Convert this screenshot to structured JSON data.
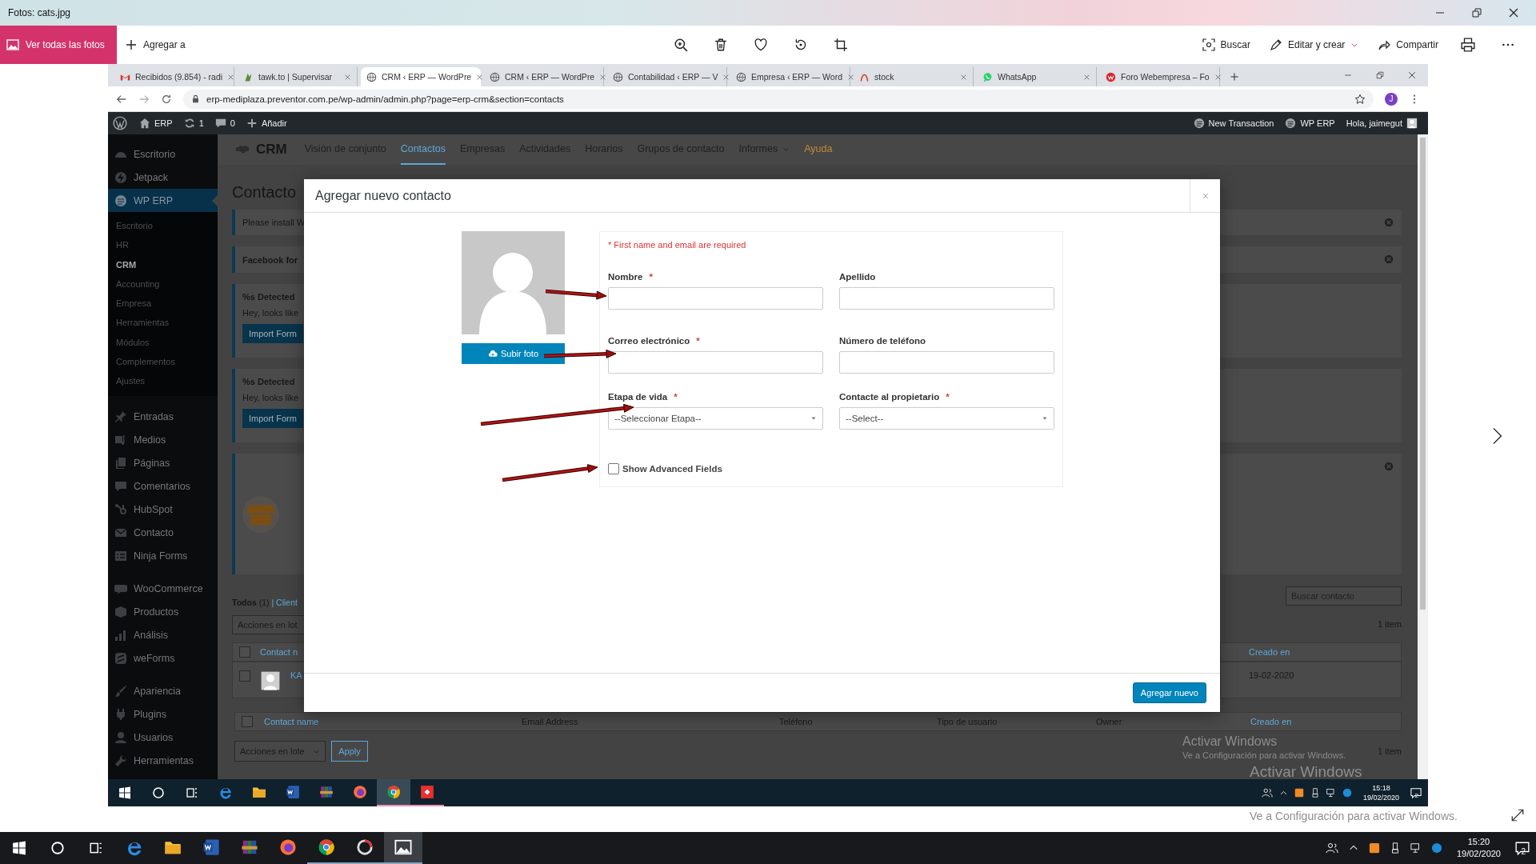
{
  "viewer": {
    "title": "Fotos: cats.jpg",
    "all_photos": "Ver todas las fotos",
    "add_to": "Agregar a",
    "search": "Buscar",
    "edit_create": "Editar y crear",
    "share": "Compartir",
    "activation": {
      "title": "Activar Windows",
      "body": "Ve a Configuración para activar Windows."
    }
  },
  "browser": {
    "tabs": [
      {
        "kind": "mail",
        "title": "Recibidos (9.854) - radi",
        "selected": false
      },
      {
        "kind": "leaf",
        "title": "tawk.to | Supervisar",
        "selected": false
      },
      {
        "kind": "globe",
        "title": "CRM ‹ ERP — WordPre",
        "selected": true
      },
      {
        "kind": "globe",
        "title": "CRM ‹ ERP — WordPre",
        "selected": false
      },
      {
        "kind": "globe",
        "title": "Contabilidad ‹ ERP — V",
        "selected": false
      },
      {
        "kind": "globe",
        "title": "Empresa ‹ ERP — Word",
        "selected": false
      },
      {
        "kind": "arch",
        "title": "stock",
        "selected": false
      },
      {
        "kind": "chat",
        "title": "WhatsApp",
        "selected": false
      },
      {
        "kind": "forum",
        "title": "Foro Webempresa – Fo",
        "selected": false
      }
    ],
    "url": "erp-mediplaza.preventor.com.pe/wp-admin/admin.php?page=erp-crm&section=contacts",
    "profile": "J"
  },
  "admin_bar": {
    "items": [
      {
        "kind": "home",
        "label": "ERP"
      },
      {
        "kind": "updates",
        "label": "1"
      },
      {
        "kind": "comments",
        "label": "0"
      },
      {
        "kind": "add",
        "label": "Añadir"
      }
    ],
    "right": [
      {
        "kind": "erp",
        "label": "New Transaction"
      },
      {
        "kind": "erp",
        "label": "WP ERP"
      }
    ],
    "greeting": "Hola, jaimegut"
  },
  "sidebar": {
    "groups": [
      [
        {
          "label": "Escritorio",
          "selected": false
        },
        {
          "label": "Jetpack",
          "selected": false
        },
        {
          "label": "WP ERP",
          "selected": true,
          "children": [
            {
              "label": "Escritorio",
              "selected": false
            },
            {
              "label": "HR",
              "selected": false
            },
            {
              "label": "CRM",
              "selected": true
            },
            {
              "label": "Accounting",
              "selected": false
            },
            {
              "label": "Empresa",
              "selected": false
            },
            {
              "label": "Herramientas",
              "selected": false
            },
            {
              "label": "Módulos",
              "selected": false
            },
            {
              "label": "Complementos",
              "selected": false
            },
            {
              "label": "Ajustes",
              "selected": false
            }
          ]
        }
      ],
      [
        {
          "label": "Entradas",
          "selected": false
        },
        {
          "label": "Medios",
          "selected": false
        },
        {
          "label": "Páginas",
          "selected": false
        },
        {
          "label": "Comentarios",
          "selected": false
        },
        {
          "label": "HubSpot",
          "selected": false
        },
        {
          "label": "Contacto",
          "selected": false
        },
        {
          "label": "Ninja Forms",
          "selected": false
        }
      ],
      [
        {
          "label": "WooCommerce",
          "selected": false
        },
        {
          "label": "Productos",
          "selected": false
        },
        {
          "label": "Análisis",
          "selected": false
        },
        {
          "label": "weForms",
          "selected": false
        }
      ],
      [
        {
          "label": "Apariencia",
          "selected": false
        },
        {
          "label": "Plugins",
          "selected": false
        },
        {
          "label": "Usuarios",
          "selected": false
        },
        {
          "label": "Herramientas",
          "selected": false
        }
      ]
    ]
  },
  "crm_nav": {
    "brand": "CRM",
    "items": [
      {
        "label": "Visión de conjunto",
        "kind": "link",
        "selected": false
      },
      {
        "label": "Contactos",
        "kind": "link",
        "selected": true
      },
      {
        "label": "Empresas",
        "kind": "link",
        "selected": false
      },
      {
        "label": "Actividades",
        "kind": "link",
        "selected": false
      },
      {
        "label": "Horarios",
        "kind": "link",
        "selected": false
      },
      {
        "label": "Grupos de contacto",
        "kind": "link",
        "selected": false
      },
      {
        "label": "Informes",
        "kind": "menu",
        "selected": false
      },
      {
        "label": "Ayuda",
        "kind": "help",
        "selected": false
      }
    ]
  },
  "page": {
    "heading": "Contacto",
    "notices": [
      {
        "kind": "plain",
        "text": "Please install W",
        "dismissible": true
      },
      {
        "kind": "bold",
        "text": "Facebook for",
        "dismissible": true
      },
      {
        "kind": "import",
        "title": "%s Detected",
        "text": "Hey, looks like",
        "button": "Import Form",
        "dismissible": false
      },
      {
        "kind": "import",
        "title": "%s Detected",
        "text": "Hey, looks like",
        "button": "Import Form",
        "dismissible": false
      },
      {
        "kind": "promo",
        "dismissible": true
      }
    ],
    "filter": {
      "label": "Todos",
      "count": "(1)",
      "link": "| Client"
    },
    "bulk_top": "Acciones en lot",
    "search_placeholder": "Buscar contacto",
    "count_top": "1 item",
    "table": {
      "header_left": "Contact n",
      "header_checked": false,
      "header_right": "Creado en",
      "row_name": "KA",
      "row_checked": false,
      "row_created": "19-02-2020",
      "footer": [
        "Contact name",
        "Email Address",
        "Teléfono",
        "Tipo de usuario",
        "Owner",
        "Creado en"
      ],
      "footer_checked": false
    },
    "bulk_bottom": "Acciones en lote",
    "apply": "Apply",
    "count_bottom": "1 item",
    "activation": {
      "title": "Activar Windows",
      "body": "Ve a Configuración para activar Windows."
    }
  },
  "modal": {
    "title": "Agregar nuevo contacto",
    "upload": "Subir foto",
    "note": "* First name and email are required",
    "required_mark": "*",
    "fields": [
      {
        "label": "Nombre",
        "required": true,
        "kind": "text"
      },
      {
        "label": "Apellido",
        "required": false,
        "kind": "text"
      },
      {
        "label": "Correo electrónico",
        "required": true,
        "kind": "text"
      },
      {
        "label": "Número de teléfono",
        "required": false,
        "kind": "text"
      },
      {
        "label": "Etapa de vida",
        "required": true,
        "kind": "select",
        "value": "--Seleccionar Etapa--"
      },
      {
        "label": "Contacte al propietario",
        "required": true,
        "kind": "select",
        "value": "--Select--"
      }
    ],
    "advanced": {
      "label": "Show Advanced Fields",
      "checked": false
    },
    "submit": "Agregar nuevo"
  },
  "shot_taskbar": {
    "apps": [
      {
        "kind": "edge",
        "selected": false,
        "running": false
      },
      {
        "kind": "folder",
        "selected": false,
        "running": false
      },
      {
        "kind": "word",
        "selected": false,
        "running": false
      },
      {
        "kind": "archive",
        "selected": false,
        "running": false
      },
      {
        "kind": "firefox",
        "selected": false,
        "running": false
      },
      {
        "kind": "chrome",
        "selected": true,
        "running": true
      },
      {
        "kind": "remote",
        "selected": false,
        "running": true
      }
    ],
    "time": "15:18",
    "date": "19/02/2020",
    "notifications": "2"
  },
  "taskbar": {
    "apps": [
      {
        "kind": "edge",
        "selected": false,
        "running": false
      },
      {
        "kind": "folder",
        "selected": false,
        "running": false
      },
      {
        "kind": "word",
        "selected": false,
        "running": false
      },
      {
        "kind": "archive",
        "selected": false,
        "running": false
      },
      {
        "kind": "firefox",
        "selected": false,
        "running": false
      },
      {
        "kind": "chrome",
        "selected": false,
        "running": true
      },
      {
        "kind": "ring",
        "selected": false,
        "running": true
      },
      {
        "kind": "photos",
        "selected": true,
        "running": true
      }
    ],
    "time": "15:20",
    "date": "19/02/2020",
    "notifications": "2"
  }
}
